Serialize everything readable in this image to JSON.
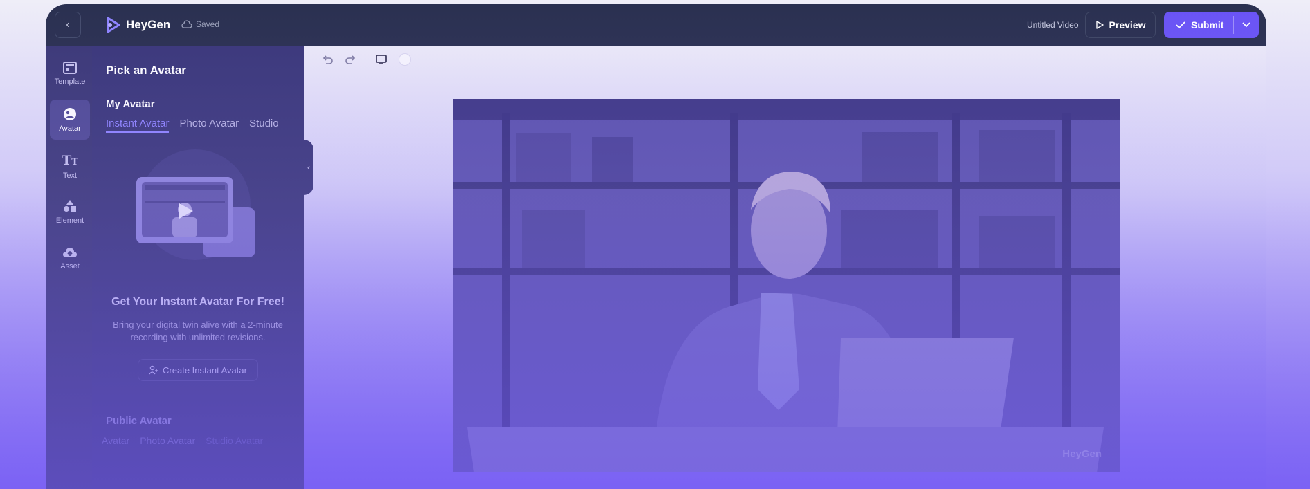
{
  "header": {
    "brand": "HeyGen",
    "save_status": "Saved",
    "video_title": "Untitled Video",
    "preview_label": "Preview",
    "submit_label": "Submit"
  },
  "sidenav": {
    "items": [
      {
        "label": "Template",
        "icon": "template-icon"
      },
      {
        "label": "Avatar",
        "icon": "avatar-icon",
        "active": true
      },
      {
        "label": "Text",
        "icon": "text-icon"
      },
      {
        "label": "Element",
        "icon": "element-icon"
      },
      {
        "label": "Asset",
        "icon": "asset-icon"
      }
    ]
  },
  "panel": {
    "title": "Pick an Avatar",
    "my_avatar": {
      "title": "My Avatar",
      "tabs": [
        "Instant Avatar",
        "Photo Avatar",
        "Studio"
      ],
      "active_tab": "Instant Avatar"
    },
    "cta": {
      "title": "Get Your Instant Avatar For Free!",
      "description": "Bring your digital twin alive with a 2-minute recording with unlimited revisions.",
      "button_label": "Create Instant Avatar"
    },
    "public_avatar": {
      "title": "Public Avatar",
      "tabs": [
        "Avatar",
        "Photo Avatar",
        "Studio Avatar"
      ]
    }
  },
  "canvas": {
    "watermark": "HeyGen"
  },
  "colors": {
    "accent": "#6a54f5",
    "topbar": "#2a3050",
    "panel": "#3a3779"
  }
}
